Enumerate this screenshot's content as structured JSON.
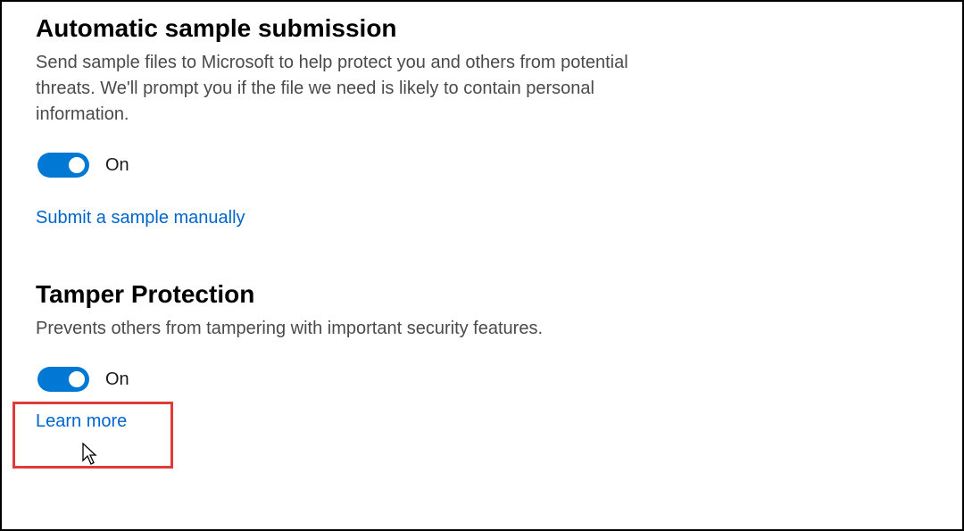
{
  "sections": {
    "automaticSampleSubmission": {
      "title": "Automatic sample submission",
      "description": "Send sample files to Microsoft to help protect you and others from potential threats. We'll prompt you if the file we need is likely to contain personal information.",
      "toggleState": "On",
      "link": "Submit a sample manually"
    },
    "tamperProtection": {
      "title": "Tamper Protection",
      "description": "Prevents others from tampering with important security features.",
      "toggleState": "On",
      "link": "Learn more"
    }
  },
  "colors": {
    "toggleActive": "#0078d4",
    "linkColor": "#0066cc",
    "highlightBorder": "#e03b3b"
  }
}
